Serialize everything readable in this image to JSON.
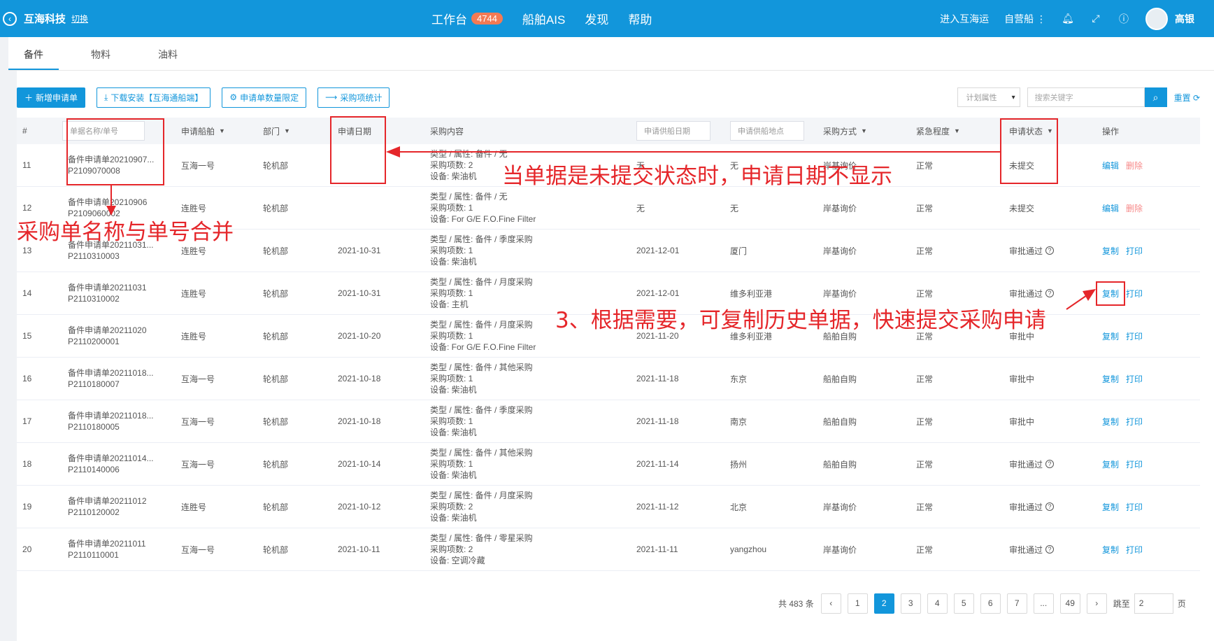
{
  "header": {
    "brand": "互海科技",
    "switch_label": "切换",
    "nav": [
      {
        "label": "工作台",
        "badge": "4744"
      },
      {
        "label": "船舶AIS"
      },
      {
        "label": "发现"
      },
      {
        "label": "帮助"
      }
    ],
    "enter_label": "进入互海运",
    "own_ship_label": "自营船 ⋮",
    "user_name": "高银"
  },
  "tabs": [
    "备件",
    "物料",
    "油料"
  ],
  "toolbar": {
    "new_label": "新增申请单",
    "download_label": "下载安装【互海通船端】",
    "limit_label": "申请单数量限定",
    "stats_label": "采购项统计"
  },
  "filters": {
    "plan_attr": "计划属性",
    "search_placeholder": "搜索关键字",
    "reset_label": "重置"
  },
  "table": {
    "headers": {
      "no": "#",
      "name": "单据名称/单号",
      "ship": "申请船舶",
      "dept": "部门",
      "date": "申请日期",
      "content": "采购内容",
      "supply_date": "申请供船日期",
      "supply_place": "申请供船地点",
      "method": "采购方式",
      "urgency": "紧急程度",
      "status": "申请状态",
      "op": "操作"
    },
    "rows": [
      {
        "no": "11",
        "name": "备件申请单20210907...",
        "code": "P2109070008",
        "ship": "互海一号",
        "dept": "轮机部",
        "date": "",
        "c1": "类型 / 属性:  备件 / 无",
        "c2": "采购项数:  2",
        "c3": "设备:  柴油机",
        "sdate": "无",
        "splace": "无",
        "method": "岸基询价",
        "urgency": "正常",
        "status": "未提交",
        "q": false,
        "op1": "编辑",
        "op2": "删除"
      },
      {
        "no": "12",
        "name": "备件申请单20210906",
        "code": "P2109060002",
        "ship": "连胜号",
        "dept": "轮机部",
        "date": "",
        "c1": "类型 / 属性:  备件 / 无",
        "c2": "采购项数:  1",
        "c3": "设备:  For G/E F.O.Fine Filter",
        "sdate": "无",
        "splace": "无",
        "method": "岸基询价",
        "urgency": "正常",
        "status": "未提交",
        "q": false,
        "op1": "编辑",
        "op2": "删除"
      },
      {
        "no": "13",
        "name": "备件申请单20211031...",
        "code": "P2110310003",
        "ship": "连胜号",
        "dept": "轮机部",
        "date": "2021-10-31",
        "c1": "类型 / 属性:  备件 / 季度采购",
        "c2": "采购项数:  1",
        "c3": "设备:  柴油机",
        "sdate": "2021-12-01",
        "splace": "厦门",
        "method": "岸基询价",
        "urgency": "正常",
        "status": "审批通过",
        "q": true,
        "op1": "复制",
        "op2": "打印"
      },
      {
        "no": "14",
        "name": "备件申请单20211031",
        "code": "P2110310002",
        "ship": "连胜号",
        "dept": "轮机部",
        "date": "2021-10-31",
        "c1": "类型 / 属性:  备件 / 月度采购",
        "c2": "采购项数:  1",
        "c3": "设备:  主机",
        "sdate": "2021-12-01",
        "splace": "维多利亚港",
        "method": "岸基询价",
        "urgency": "正常",
        "status": "审批通过",
        "q": true,
        "op1": "复制",
        "op2": "打印"
      },
      {
        "no": "15",
        "name": "备件申请单20211020",
        "code": "P2110200001",
        "ship": "连胜号",
        "dept": "轮机部",
        "date": "2021-10-20",
        "c1": "类型 / 属性:  备件 / 月度采购",
        "c2": "采购项数:  1",
        "c3": "设备:  For G/E F.O.Fine Filter",
        "sdate": "2021-11-20",
        "splace": "维多利亚港",
        "method": "船舶自购",
        "urgency": "正常",
        "status": "审批中",
        "q": false,
        "op1": "复制",
        "op2": "打印"
      },
      {
        "no": "16",
        "name": "备件申请单20211018...",
        "code": "P2110180007",
        "ship": "互海一号",
        "dept": "轮机部",
        "date": "2021-10-18",
        "c1": "类型 / 属性:  备件 / 其他采购",
        "c2": "采购项数:  1",
        "c3": "设备:  柴油机",
        "sdate": "2021-11-18",
        "splace": "东京",
        "method": "船舶自购",
        "urgency": "正常",
        "status": "审批中",
        "q": false,
        "op1": "复制",
        "op2": "打印"
      },
      {
        "no": "17",
        "name": "备件申请单20211018...",
        "code": "P2110180005",
        "ship": "互海一号",
        "dept": "轮机部",
        "date": "2021-10-18",
        "c1": "类型 / 属性:  备件 / 季度采购",
        "c2": "采购项数:  1",
        "c3": "设备:  柴油机",
        "sdate": "2021-11-18",
        "splace": "南京",
        "method": "船舶自购",
        "urgency": "正常",
        "status": "审批中",
        "q": false,
        "op1": "复制",
        "op2": "打印"
      },
      {
        "no": "18",
        "name": "备件申请单20211014...",
        "code": "P2110140006",
        "ship": "互海一号",
        "dept": "轮机部",
        "date": "2021-10-14",
        "c1": "类型 / 属性:  备件 / 其他采购",
        "c2": "采购项数:  1",
        "c3": "设备:  柴油机",
        "sdate": "2021-11-14",
        "splace": "扬州",
        "method": "船舶自购",
        "urgency": "正常",
        "status": "审批通过",
        "q": true,
        "op1": "复制",
        "op2": "打印"
      },
      {
        "no": "19",
        "name": "备件申请单20211012",
        "code": "P2110120002",
        "ship": "连胜号",
        "dept": "轮机部",
        "date": "2021-10-12",
        "c1": "类型 / 属性:  备件 / 月度采购",
        "c2": "采购项数:  2",
        "c3": "设备:  柴油机",
        "sdate": "2021-11-12",
        "splace": "北京",
        "method": "岸基询价",
        "urgency": "正常",
        "status": "审批通过",
        "q": true,
        "op1": "复制",
        "op2": "打印"
      },
      {
        "no": "20",
        "name": "备件申请单20211011",
        "code": "P2110110001",
        "ship": "互海一号",
        "dept": "轮机部",
        "date": "2021-10-11",
        "c1": "类型 / 属性:  备件 / 零星采购",
        "c2": "采购项数:  2",
        "c3": "设备:  空调冷藏",
        "sdate": "2021-11-11",
        "splace": "yangzhou",
        "method": "岸基询价",
        "urgency": "正常",
        "status": "审批通过",
        "q": true,
        "op1": "复制",
        "op2": "打印"
      }
    ]
  },
  "pagination": {
    "total": "共 483 条",
    "pages": [
      "1",
      "2",
      "3",
      "4",
      "5",
      "6",
      "7",
      "...",
      "49"
    ],
    "current": "2",
    "jump_label": "跳至",
    "jump_value": "2",
    "page_suffix": "页"
  },
  "annotations": {
    "a1": "当单据是未提交状态时，申请日期不显示",
    "a2": "采购单名称与单号合并",
    "a3": "3、根据需要，可复制历史单据，快速提交采购申请"
  },
  "colors": {
    "primary": "#1296db",
    "annotation": "#e5262a",
    "badge": "#f47a54"
  }
}
